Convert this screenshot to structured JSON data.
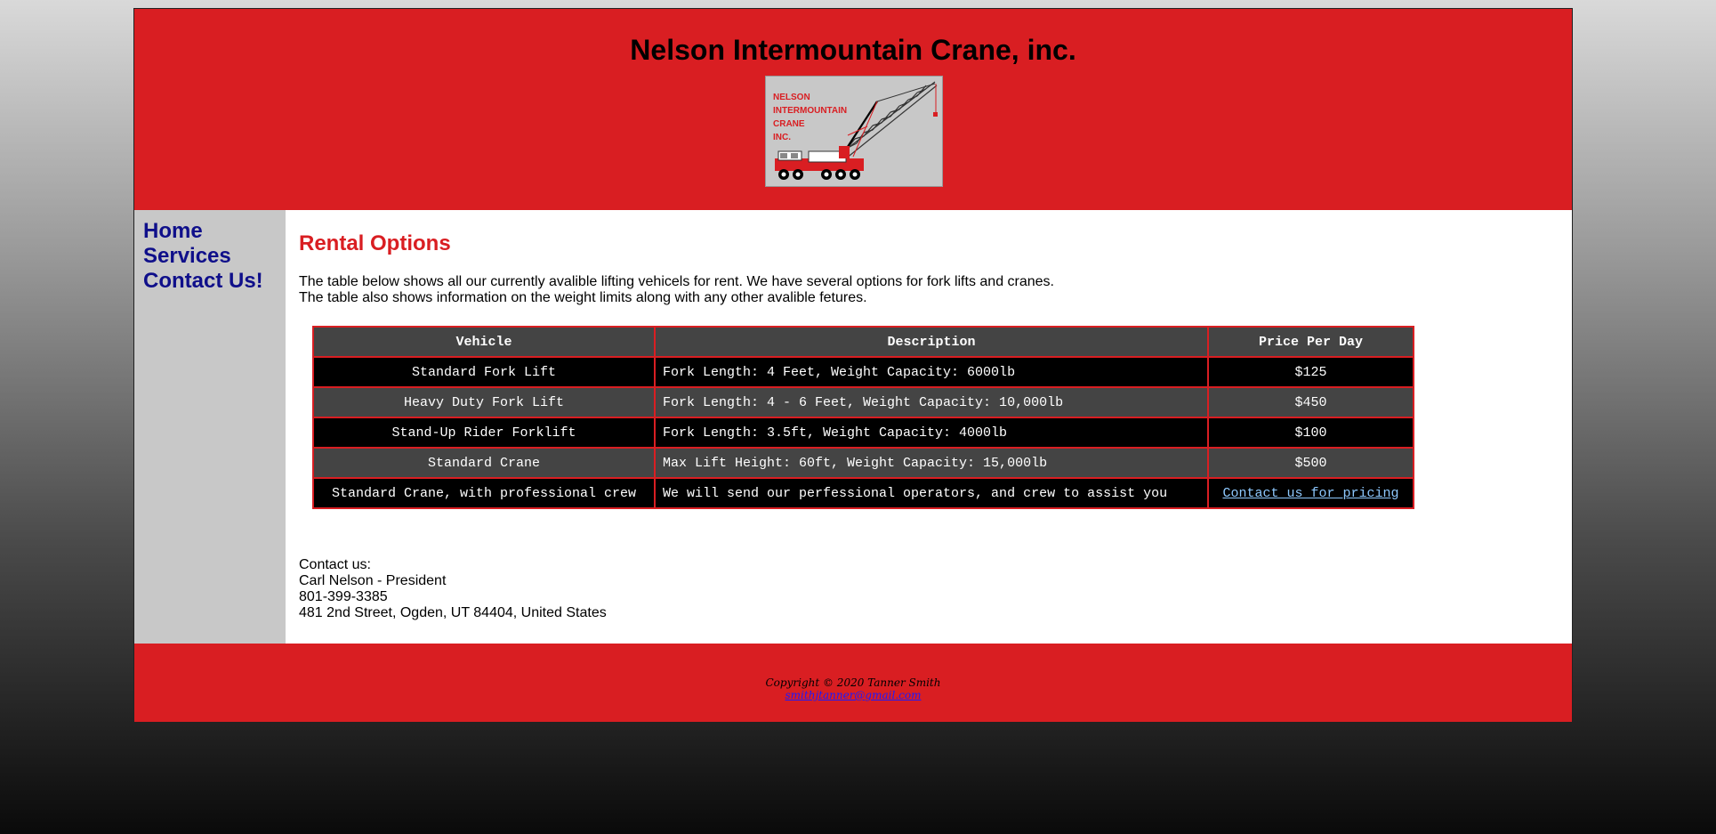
{
  "header": {
    "title": "Nelson Intermountain Crane, inc.",
    "logo_text": "NELSON\nINTERMOUNTAIN\nCRANE\nINC."
  },
  "nav": {
    "items": [
      {
        "label": "Home"
      },
      {
        "label": "Services"
      },
      {
        "label": "Contact Us!"
      }
    ]
  },
  "main": {
    "title": "Rental Options",
    "intro_line1": "The table below shows all our currently avalible lifting vehicels for rent. We have several options for fork lifts and cranes.",
    "intro_line2": "The table also shows information on the weight limits along with any other avalible fetures.",
    "table": {
      "headers": [
        "Vehicle",
        "Description",
        "Price Per Day"
      ],
      "rows": [
        {
          "vehicle": "Standard Fork Lift",
          "description": "Fork Length: 4 Feet, Weight Capacity: 6000lb",
          "price": "$125"
        },
        {
          "vehicle": "Heavy Duty Fork Lift",
          "description": "Fork Length: 4 - 6 Feet, Weight Capacity: 10,000lb",
          "price": "$450"
        },
        {
          "vehicle": "Stand-Up Rider Forklift",
          "description": "Fork Length: 3.5ft, Weight Capacity: 4000lb",
          "price": "$100"
        },
        {
          "vehicle": "Standard Crane",
          "description": "Max Lift Height: 60ft, Weight Capacity: 15,000lb",
          "price": "$500"
        },
        {
          "vehicle": "Standard Crane, with professional crew",
          "description": "We will send our perfessional operators, and crew to assist you",
          "price": "Contact us for pricing"
        }
      ]
    },
    "contact": {
      "heading": "Contact us:",
      "name": "Carl Nelson - President",
      "phone": "801-399-3385",
      "address": "481 2nd Street, Ogden, UT 84404, United States"
    }
  },
  "footer": {
    "copyright": "Copyright © 2020 Tanner Smith",
    "email": "smithjtanner@gmail.com"
  },
  "colors": {
    "brand_red": "#d91e22",
    "nav_blue": "#0f0f8a",
    "sidebar_grey": "#c8c8c8",
    "table_grey": "#444444"
  }
}
